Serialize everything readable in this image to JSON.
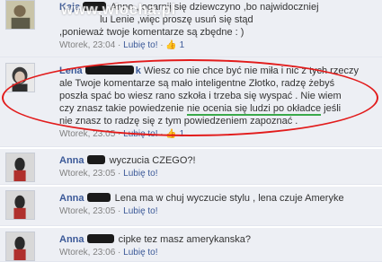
{
  "watermark": "www.wiocha.pl",
  "comments": [
    {
      "author": "Kaja",
      "text_lines": [
        "Anno , ogarnij się dziewczyno ,bo najwidoczniej",
        "lu Lenie ,więc proszę usuń się stąd",
        ",ponieważ twoje komentarze są zbędne : )"
      ],
      "timestamp": "Wtorek, 23:04",
      "like_label": "Lubię to!",
      "like_count": "1"
    },
    {
      "author": "Lena",
      "author_suffix": "k",
      "text_lines": [
        "Wiesz co nie chce być nie miła i nic z tych rzeczy",
        "ale Twoje komentarze są mało inteligentne Złotko, radzę żebyś",
        "poszła spać bo wiesz rano szkoła i trzeba się wyspać . Nie wiem",
        "czy znasz takie powiedzenie",
        "nie ocenia się ludzi po okładce",
        "jeśli",
        "nie znasz to radzę się z tym powiedzeniem zapoznać ."
      ],
      "timestamp": "Wtorek, 23:05",
      "like_label": "Lubię to!",
      "like_count": "1"
    },
    {
      "author": "Anna",
      "text": "wyczucia CZEGO?!",
      "timestamp": "Wtorek, 23:05",
      "like_label": "Lubię to!"
    },
    {
      "author": "Anna",
      "text": "Lena ma w chuj wyczucie stylu , lena czuje Ameryke",
      "timestamp": "Wtorek, 23:05",
      "like_label": "Lubię to!"
    },
    {
      "author": "Anna",
      "text": "cipke tez masz amerykanska?",
      "timestamp": "Wtorek, 23:06",
      "like_label": "Lubię to!"
    }
  ]
}
